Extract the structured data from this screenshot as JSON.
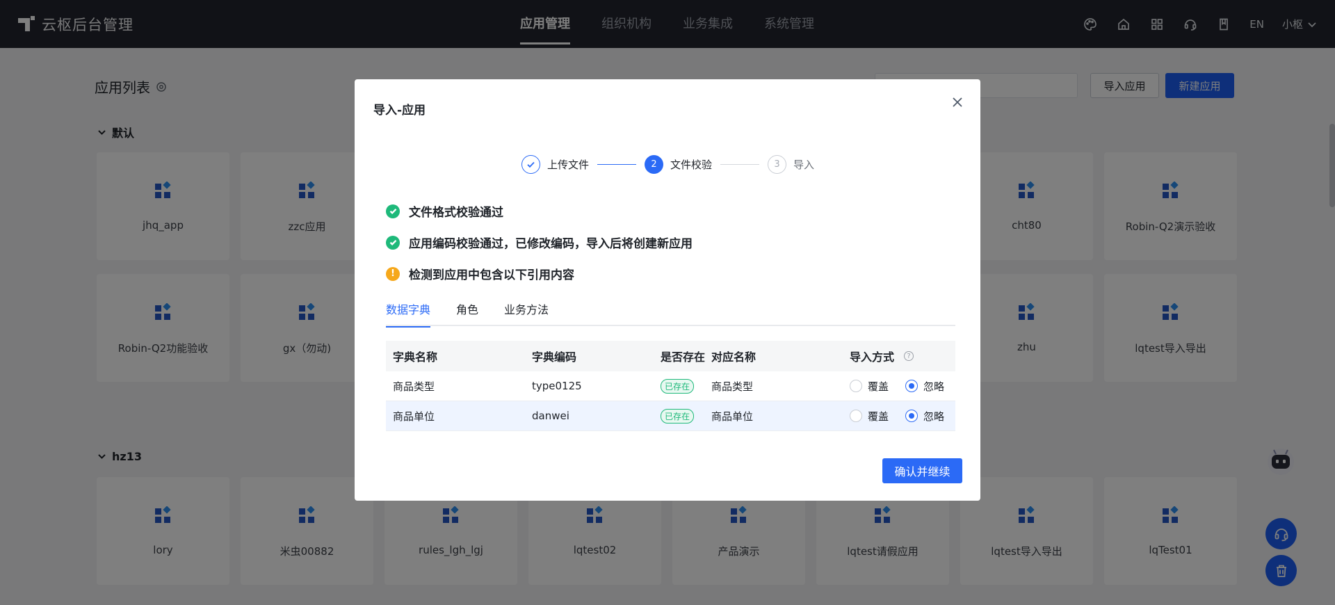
{
  "app": {
    "title": "云枢后台管理"
  },
  "nav": {
    "items": [
      "应用管理",
      "组织机构",
      "业务集成",
      "系统管理"
    ],
    "active": 0
  },
  "header": {
    "lang": "EN",
    "user": "小枢",
    "icons": [
      "palette-icon",
      "home-icon",
      "apps-grid-icon",
      "headset-icon",
      "book-icon"
    ]
  },
  "page": {
    "title": "应用列表",
    "import_label": "导入应用",
    "new_label": "新建应用",
    "groups": [
      {
        "name": "默认",
        "rows": [
          [
            "jhq_app",
            "zzc应用",
            "",
            "",
            "",
            "",
            "cht80",
            "Robin-Q2演示验收"
          ],
          [
            "Robin-Q2功能验收",
            "gx（勿动)",
            "",
            "",
            "",
            "",
            "zhu",
            "lqtest导入导出"
          ]
        ]
      },
      {
        "name": "hz13",
        "rows": [
          [
            "lory",
            "米虫00882",
            "rules_lgh_lgj",
            "lqtest02",
            "产品演示",
            "lqtest请假应用",
            "lqtest导入导出",
            "lqTest01"
          ]
        ]
      }
    ]
  },
  "modal": {
    "title": "导入-应用",
    "steps": [
      {
        "num": "1",
        "label": "上传文件",
        "state": "done"
      },
      {
        "num": "2",
        "label": "文件校验",
        "state": "current"
      },
      {
        "num": "3",
        "label": "导入",
        "state": "todo"
      }
    ],
    "checks": [
      {
        "text": "文件格式校验通过",
        "status": "ok"
      },
      {
        "text": "应用编码校验通过，已修改编码，导入后将创建新应用",
        "status": "ok"
      },
      {
        "text": "检测到应用中包含以下引用内容",
        "status": "warn"
      }
    ],
    "tabs": [
      "数据字典",
      "角色",
      "业务方法"
    ],
    "active_tab": 0,
    "table": {
      "headers": [
        "字典名称",
        "字典编码",
        "是否存在",
        "对应名称",
        "导入方式"
      ],
      "rows": [
        {
          "name": "商品类型",
          "code": "type0125",
          "exists": "已存在",
          "mapped": "商品类型",
          "option_overwrite": "覆盖",
          "option_ignore": "忽略",
          "selected": "忽略"
        },
        {
          "name": "商品单位",
          "code": "danwei",
          "exists": "已存在",
          "mapped": "商品单位",
          "option_overwrite": "覆盖",
          "option_ignore": "忽略",
          "selected": "忽略"
        }
      ]
    },
    "confirm_label": "确认并继续"
  },
  "colors": {
    "primary": "#2b6af6",
    "topbar": "#23252e",
    "success": "#1eb97a",
    "warning": "#f6a81b"
  }
}
